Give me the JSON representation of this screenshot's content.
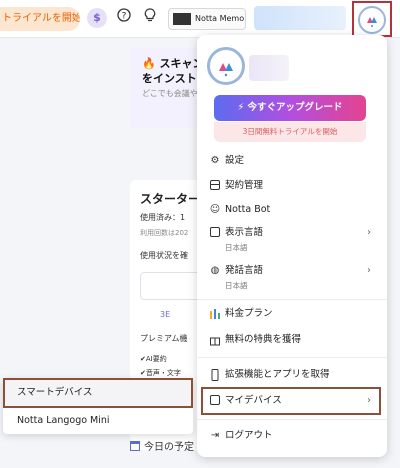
{
  "topbar": {
    "trial_button": "トライアルを開始",
    "coin_symbol": "$",
    "help_icon": "question-circle-icon",
    "bulb_icon": "lightbulb-icon",
    "memo_chip": "Notta Memo"
  },
  "background": {
    "promo_line1": "🔥 スキャン",
    "promo_line2": "をインスト・",
    "promo_sub": "どこでも会議や",
    "starter_title": "スターター",
    "used": "使用済み：1",
    "limit_note": "利用回数は202",
    "check_usage": "使用状況を確",
    "three_e": "3E",
    "premium": "プレミアム機",
    "feature_ai": "✔AI要約",
    "feature_voice": "✔音声・文字",
    "today": "今日の予定"
  },
  "menu": {
    "upgrade_button": "⚡ 今すぐアップグレード",
    "trial_note": "3日間無料トライアルを開始",
    "items": [
      {
        "label": "設定",
        "icon": "gear-icon"
      },
      {
        "label": "契約管理",
        "icon": "billing-icon"
      },
      {
        "label": "Notta Bot",
        "icon": "bot-icon"
      },
      {
        "label": "表示言語",
        "sub": "日本語",
        "icon": "display-language-icon"
      },
      {
        "label": "発話言語",
        "sub": "日本語",
        "icon": "globe-icon"
      },
      {
        "label": "料金プラン",
        "icon": "pricing-icon"
      },
      {
        "label": "無料の特典を獲得",
        "icon": "gift-icon"
      },
      {
        "label": "拡張機能とアプリを取得",
        "icon": "mobile-icon"
      },
      {
        "label": "マイデバイス",
        "icon": "device-icon"
      },
      {
        "label": "ログアウト",
        "icon": "logout-icon"
      }
    ]
  },
  "submenu": {
    "items": [
      "スマートデバイス",
      "Notta Langogo Mini"
    ]
  },
  "colors": {
    "accent": "#e8630a",
    "highlight_border": "#8b4f3a",
    "avatar_border": "#b3333a",
    "trial_note": "#e05a5a"
  }
}
